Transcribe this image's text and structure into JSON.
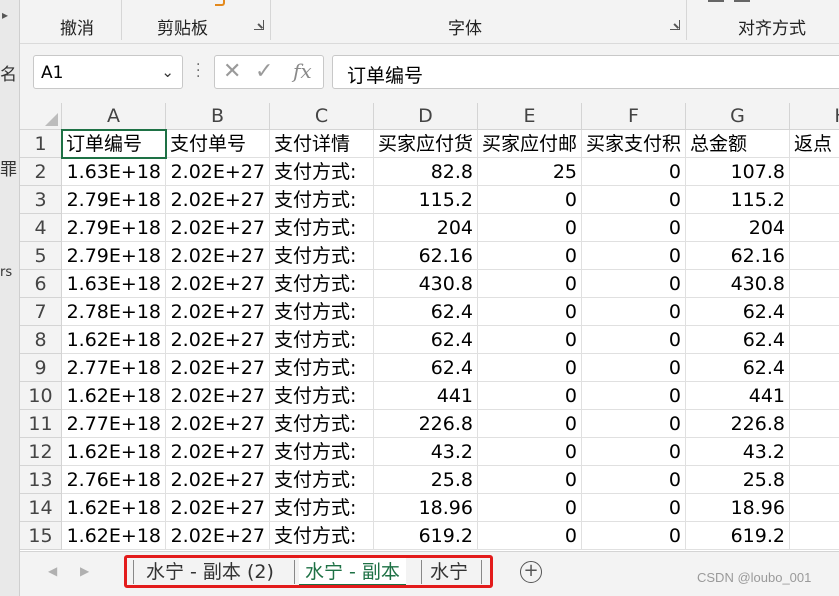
{
  "ribbon": {
    "groups": [
      {
        "label": "撤消"
      },
      {
        "label": "剪贴板"
      },
      {
        "label": "字体"
      },
      {
        "label": "对齐方式"
      }
    ]
  },
  "left_window_fragments": [
    "名",
    "罪",
    "rs"
  ],
  "formula_bar": {
    "name_box": "A1",
    "fx_label": "fx",
    "cancel_glyph": "✕",
    "enter_glyph": "✓",
    "content": "订单编号"
  },
  "columns": [
    "A",
    "B",
    "C",
    "D",
    "E",
    "F",
    "G",
    "H"
  ],
  "rows": [
    "1",
    "2",
    "3",
    "4",
    "5",
    "6",
    "7",
    "8",
    "9",
    "10",
    "11",
    "12",
    "13",
    "14",
    "15"
  ],
  "cells": [
    [
      "订单编号",
      "支付单号",
      "支付详情",
      "买家应付货",
      "买家应付邮",
      "买家支付积",
      "总金额",
      "返点"
    ],
    [
      "1.63E+18",
      "2.02E+27",
      "支付方式:",
      "82.8",
      "25",
      "0",
      "107.8",
      ""
    ],
    [
      "2.79E+18",
      "2.02E+27",
      "支付方式:",
      "115.2",
      "0",
      "0",
      "115.2",
      ""
    ],
    [
      "2.79E+18",
      "2.02E+27",
      "支付方式:",
      "204",
      "0",
      "0",
      "204",
      ""
    ],
    [
      "2.79E+18",
      "2.02E+27",
      "支付方式:",
      "62.16",
      "0",
      "0",
      "62.16",
      ""
    ],
    [
      "1.63E+18",
      "2.02E+27",
      "支付方式:",
      "430.8",
      "0",
      "0",
      "430.8",
      ""
    ],
    [
      "2.78E+18",
      "2.02E+27",
      "支付方式:",
      "62.4",
      "0",
      "0",
      "62.4",
      ""
    ],
    [
      "1.62E+18",
      "2.02E+27",
      "支付方式:",
      "62.4",
      "0",
      "0",
      "62.4",
      ""
    ],
    [
      "2.77E+18",
      "2.02E+27",
      "支付方式:",
      "62.4",
      "0",
      "0",
      "62.4",
      ""
    ],
    [
      "1.62E+18",
      "2.02E+27",
      "支付方式:",
      "441",
      "0",
      "0",
      "441",
      ""
    ],
    [
      "2.77E+18",
      "2.02E+27",
      "支付方式:",
      "226.8",
      "0",
      "0",
      "226.8",
      ""
    ],
    [
      "1.62E+18",
      "2.02E+27",
      "支付方式:",
      "43.2",
      "0",
      "0",
      "43.2",
      ""
    ],
    [
      "2.76E+18",
      "2.02E+27",
      "支付方式:",
      "25.8",
      "0",
      "0",
      "25.8",
      ""
    ],
    [
      "1.62E+18",
      "2.02E+27",
      "支付方式:",
      "18.96",
      "0",
      "0",
      "18.96",
      ""
    ],
    [
      "1.62E+18",
      "2.02E+27",
      "支付方式:",
      "619.2",
      "0",
      "0",
      "619.2",
      ""
    ]
  ],
  "sheet_tabs": [
    {
      "label": "水宁 - 副本 (2)",
      "active": false
    },
    {
      "label": "水宁 - 副本",
      "active": true
    },
    {
      "label": "水宁",
      "active": false
    }
  ],
  "nav": {
    "prev": "◀",
    "next": "▶",
    "add": "+"
  },
  "watermark": "CSDN @loubo_001",
  "colors": {
    "accent_green": "#1e7145",
    "highlight_red": "#e31b1b"
  }
}
